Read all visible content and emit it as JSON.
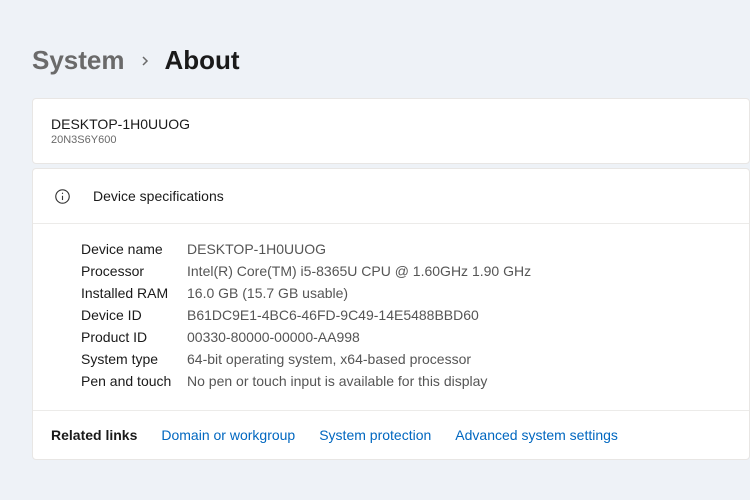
{
  "breadcrumb": {
    "parent": "System",
    "current": "About"
  },
  "computer": {
    "name": "DESKTOP-1H0UUOG",
    "model": "20N3S6Y600"
  },
  "specs": {
    "title": "Device specifications",
    "rows": {
      "device_name": {
        "label": "Device name",
        "value": "DESKTOP-1H0UUOG"
      },
      "processor": {
        "label": "Processor",
        "value": "Intel(R) Core(TM) i5-8365U CPU @ 1.60GHz   1.90 GHz"
      },
      "ram": {
        "label": "Installed RAM",
        "value": "16.0 GB (15.7 GB usable)"
      },
      "device_id": {
        "label": "Device ID",
        "value": "B61DC9E1-4BC6-46FD-9C49-14E5488BBD60"
      },
      "product_id": {
        "label": "Product ID",
        "value": "00330-80000-00000-AA998"
      },
      "system_type": {
        "label": "System type",
        "value": "64-bit operating system, x64-based processor"
      },
      "pen_touch": {
        "label": "Pen and touch",
        "value": "No pen or touch input is available for this display"
      }
    }
  },
  "related": {
    "label": "Related links",
    "links": {
      "domain": "Domain or workgroup",
      "protection": "System protection",
      "advanced": "Advanced system settings"
    }
  }
}
